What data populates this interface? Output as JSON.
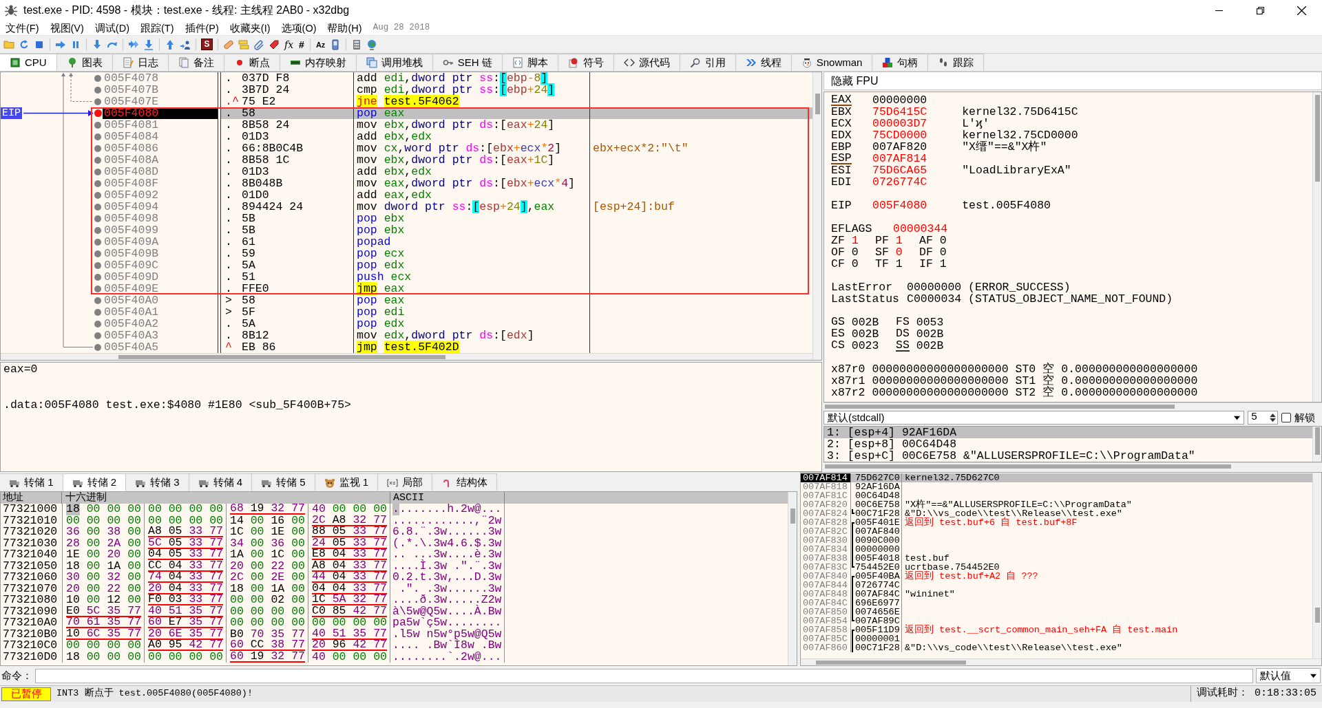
{
  "window": {
    "title": "test.exe - PID: 4598 - 模块：test.exe - 线程: 主线程 2AB0 - x32dbg"
  },
  "menu": {
    "items": [
      "文件(F)",
      "视图(V)",
      "调试(D)",
      "跟踪(T)",
      "插件(P)",
      "收藏夹(I)",
      "选项(O)",
      "帮助(H)"
    ],
    "build_date": "Aug 28 2018"
  },
  "toolbar": {
    "glyph_buttons": [
      "S",
      "fx",
      "#",
      "Az"
    ]
  },
  "tabs": [
    {
      "label": "CPU",
      "selected": true
    },
    {
      "label": "图表",
      "selected": false
    },
    {
      "label": "日志",
      "selected": false
    },
    {
      "label": "备注",
      "selected": false
    },
    {
      "label": "断点",
      "selected": false
    },
    {
      "label": "内存映射",
      "selected": false
    },
    {
      "label": "调用堆栈",
      "selected": false
    },
    {
      "label": "SEH 链",
      "selected": false
    },
    {
      "label": "脚本",
      "selected": false
    },
    {
      "label": "符号",
      "selected": false
    },
    {
      "label": "源代码",
      "selected": false
    },
    {
      "label": "引用",
      "selected": false
    },
    {
      "label": "线程",
      "selected": false
    },
    {
      "label": "Snowman",
      "selected": false
    },
    {
      "label": "句柄",
      "selected": false
    },
    {
      "label": "跟踪",
      "selected": false
    }
  ],
  "disassembly": {
    "eip_label": "EIP",
    "rows_above": [
      {
        "address": "005F4078",
        "mark": {
          "text": ".",
          "kind": "plain"
        },
        "bytes": "037D F8",
        "mnemonic": {
          "kind": "general",
          "text": "add"
        },
        "operands": [
          {
            "kind": "reg",
            "text": "edi"
          },
          {
            "kind": "plain",
            "text": ","
          },
          {
            "kind": "size",
            "text": "dword ptr"
          },
          {
            "kind": "seg",
            "text": "ss"
          },
          {
            "kind": "plain",
            "text": ":"
          },
          {
            "kind": "sbr",
            "text": "["
          },
          {
            "kind": "base",
            "text": "ebp"
          },
          {
            "kind": "op",
            "text": "-"
          },
          {
            "kind": "val",
            "text": "8"
          },
          {
            "kind": "sbr",
            "text": "]"
          }
        ],
        "breakpoint": false,
        "selected": false
      },
      {
        "address": "005F407B",
        "mark": {
          "text": ".",
          "kind": "plain"
        },
        "bytes": "3B7D 24",
        "mnemonic": {
          "kind": "general",
          "text": "cmp"
        },
        "operands": [
          {
            "kind": "reg",
            "text": "edi"
          },
          {
            "kind": "plain",
            "text": ","
          },
          {
            "kind": "size",
            "text": "dword ptr"
          },
          {
            "kind": "seg",
            "text": "ss"
          },
          {
            "kind": "plain",
            "text": ":"
          },
          {
            "kind": "sbr",
            "text": "["
          },
          {
            "kind": "base",
            "text": "ebp"
          },
          {
            "kind": "op",
            "text": "+"
          },
          {
            "kind": "val",
            "text": "24"
          },
          {
            "kind": "sbr",
            "text": "]"
          }
        ],
        "breakpoint": false,
        "selected": false
      },
      {
        "address": "005F407E",
        "mark": {
          "text": ".^",
          "kind": "jump"
        },
        "bytes": "75 E2",
        "mnemonic": {
          "kind": "jcc",
          "text": "jne"
        },
        "operands": [
          {
            "kind": "target",
            "text": "test.5F4062"
          }
        ],
        "breakpoint": false,
        "selected": false
      }
    ],
    "marked_rows": [
      {
        "address": "005F4080",
        "mark": {
          "text": ".",
          "kind": "plain"
        },
        "bytes": "58",
        "mnemonic": {
          "kind": "pushpop",
          "text": "pop"
        },
        "operands": [
          {
            "kind": "reg",
            "text": "eax"
          }
        ],
        "breakpoint": true,
        "selected": true
      },
      {
        "address": "005F4081",
        "mark": {
          "text": ".",
          "kind": "plain"
        },
        "bytes": "8B58 24",
        "mnemonic": {
          "kind": "general",
          "text": "mov"
        },
        "operands": [
          {
            "kind": "reg",
            "text": "ebx"
          },
          {
            "kind": "plain",
            "text": ","
          },
          {
            "kind": "size",
            "text": "dword ptr"
          },
          {
            "kind": "seg",
            "text": "ds"
          },
          {
            "kind": "plain",
            "text": ":"
          },
          {
            "kind": "br",
            "text": "["
          },
          {
            "kind": "base",
            "text": "eax"
          },
          {
            "kind": "op",
            "text": "+"
          },
          {
            "kind": "val",
            "text": "24"
          },
          {
            "kind": "br",
            "text": "]"
          }
        ],
        "breakpoint": false,
        "selected": false
      },
      {
        "address": "005F4084",
        "mark": {
          "text": ".",
          "kind": "plain"
        },
        "bytes": "01D3",
        "mnemonic": {
          "kind": "general",
          "text": "add"
        },
        "operands": [
          {
            "kind": "reg",
            "text": "ebx"
          },
          {
            "kind": "plain",
            "text": ","
          },
          {
            "kind": "reg",
            "text": "edx"
          }
        ],
        "breakpoint": false,
        "selected": false
      },
      {
        "address": "005F4086",
        "mark": {
          "text": ".",
          "kind": "plain"
        },
        "bytes": "66:8B0C4B",
        "mnemonic": {
          "kind": "general",
          "text": "mov"
        },
        "operands": [
          {
            "kind": "reg",
            "text": "cx"
          },
          {
            "kind": "plain",
            "text": ","
          },
          {
            "kind": "size",
            "text": "word ptr"
          },
          {
            "kind": "seg",
            "text": "ds"
          },
          {
            "kind": "plain",
            "text": ":"
          },
          {
            "kind": "br",
            "text": "["
          },
          {
            "kind": "base",
            "text": "ebx"
          },
          {
            "kind": "op",
            "text": "+"
          },
          {
            "kind": "idx",
            "text": "ecx"
          },
          {
            "kind": "op",
            "text": "*"
          },
          {
            "kind": "scale",
            "text": "2"
          },
          {
            "kind": "br",
            "text": "]"
          }
        ],
        "comment": "ebx+ecx*2:\"\\t\"",
        "breakpoint": false,
        "selected": false
      },
      {
        "address": "005F408A",
        "mark": {
          "text": ".",
          "kind": "plain"
        },
        "bytes": "8B58 1C",
        "mnemonic": {
          "kind": "general",
          "text": "mov"
        },
        "operands": [
          {
            "kind": "reg",
            "text": "ebx"
          },
          {
            "kind": "plain",
            "text": ","
          },
          {
            "kind": "size",
            "text": "dword ptr"
          },
          {
            "kind": "seg",
            "text": "ds"
          },
          {
            "kind": "plain",
            "text": ":"
          },
          {
            "kind": "br",
            "text": "["
          },
          {
            "kind": "base",
            "text": "eax"
          },
          {
            "kind": "op",
            "text": "+"
          },
          {
            "kind": "val",
            "text": "1C"
          },
          {
            "kind": "br",
            "text": "]"
          }
        ],
        "breakpoint": false,
        "selected": false
      },
      {
        "address": "005F408D",
        "mark": {
          "text": ".",
          "kind": "plain"
        },
        "bytes": "01D3",
        "mnemonic": {
          "kind": "general",
          "text": "add"
        },
        "operands": [
          {
            "kind": "reg",
            "text": "ebx"
          },
          {
            "kind": "plain",
            "text": ","
          },
          {
            "kind": "reg",
            "text": "edx"
          }
        ],
        "breakpoint": false,
        "selected": false
      },
      {
        "address": "005F408F",
        "mark": {
          "text": ".",
          "kind": "plain"
        },
        "bytes": "8B048B",
        "mnemonic": {
          "kind": "general",
          "text": "mov"
        },
        "operands": [
          {
            "kind": "reg",
            "text": "eax"
          },
          {
            "kind": "plain",
            "text": ","
          },
          {
            "kind": "size",
            "text": "dword ptr"
          },
          {
            "kind": "seg",
            "text": "ds"
          },
          {
            "kind": "plain",
            "text": ":"
          },
          {
            "kind": "br",
            "text": "["
          },
          {
            "kind": "base",
            "text": "ebx"
          },
          {
            "kind": "op",
            "text": "+"
          },
          {
            "kind": "idx",
            "text": "ecx"
          },
          {
            "kind": "op",
            "text": "*"
          },
          {
            "kind": "scale",
            "text": "4"
          },
          {
            "kind": "br",
            "text": "]"
          }
        ],
        "breakpoint": false,
        "selected": false
      },
      {
        "address": "005F4092",
        "mark": {
          "text": ".",
          "kind": "plain"
        },
        "bytes": "01D0",
        "mnemonic": {
          "kind": "general",
          "text": "add"
        },
        "operands": [
          {
            "kind": "reg",
            "text": "eax"
          },
          {
            "kind": "plain",
            "text": ","
          },
          {
            "kind": "reg",
            "text": "edx"
          }
        ],
        "breakpoint": false,
        "selected": false
      },
      {
        "address": "005F4094",
        "mark": {
          "text": ".",
          "kind": "plain"
        },
        "bytes": "894424 24",
        "mnemonic": {
          "kind": "general",
          "text": "mov"
        },
        "operands": [
          {
            "kind": "size",
            "text": "dword ptr"
          },
          {
            "kind": "seg",
            "text": "ss"
          },
          {
            "kind": "plain",
            "text": ":"
          },
          {
            "kind": "sbr",
            "text": "["
          },
          {
            "kind": "base",
            "text": "esp"
          },
          {
            "kind": "op",
            "text": "+"
          },
          {
            "kind": "val",
            "text": "24"
          },
          {
            "kind": "sbr",
            "text": "]"
          },
          {
            "kind": "plain",
            "text": ","
          },
          {
            "kind": "reg",
            "text": "eax"
          }
        ],
        "comment": "[esp+24]:buf",
        "breakpoint": false,
        "selected": false
      },
      {
        "address": "005F4098",
        "mark": {
          "text": ".",
          "kind": "plain"
        },
        "bytes": "5B",
        "mnemonic": {
          "kind": "pushpop",
          "text": "pop"
        },
        "operands": [
          {
            "kind": "reg",
            "text": "ebx"
          }
        ],
        "breakpoint": false,
        "selected": false
      },
      {
        "address": "005F4099",
        "mark": {
          "text": ".",
          "kind": "plain"
        },
        "bytes": "5B",
        "mnemonic": {
          "kind": "pushpop",
          "text": "pop"
        },
        "operands": [
          {
            "kind": "reg",
            "text": "ebx"
          }
        ],
        "breakpoint": false,
        "selected": false
      },
      {
        "address": "005F409A",
        "mark": {
          "text": ".",
          "kind": "plain"
        },
        "bytes": "61",
        "mnemonic": {
          "kind": "pushpop",
          "text": "popad"
        },
        "breakpoint": false,
        "selected": false
      },
      {
        "address": "005F409B",
        "mark": {
          "text": ".",
          "kind": "plain"
        },
        "bytes": "59",
        "mnemonic": {
          "kind": "pushpop",
          "text": "pop"
        },
        "operands": [
          {
            "kind": "reg",
            "text": "ecx"
          }
        ],
        "breakpoint": false,
        "selected": false
      },
      {
        "address": "005F409C",
        "mark": {
          "text": ".",
          "kind": "plain"
        },
        "bytes": "5A",
        "mnemonic": {
          "kind": "pushpop",
          "text": "pop"
        },
        "operands": [
          {
            "kind": "reg",
            "text": "edx"
          }
        ],
        "breakpoint": false,
        "selected": false
      },
      {
        "address": "005F409D",
        "mark": {
          "text": ".",
          "kind": "plain"
        },
        "bytes": "51",
        "mnemonic": {
          "kind": "pushpop",
          "text": "push"
        },
        "operands": [
          {
            "kind": "reg",
            "text": "ecx"
          }
        ],
        "breakpoint": false,
        "selected": false
      },
      {
        "address": "005F409E",
        "mark": {
          "text": ".",
          "kind": "plain"
        },
        "bytes": "FFE0",
        "mnemonic": {
          "kind": "jmp",
          "text": "jmp"
        },
        "operands": [
          {
            "kind": "reg",
            "text": "eax"
          }
        ],
        "breakpoint": false,
        "selected": false
      }
    ],
    "rows_below": [
      {
        "address": "005F40A0",
        "mark": {
          "text": ">",
          "kind": "plain"
        },
        "bytes": "58",
        "mnemonic": {
          "kind": "pushpop",
          "text": "pop"
        },
        "operands": [
          {
            "kind": "reg",
            "text": "eax"
          }
        ],
        "breakpoint": false,
        "selected": false
      },
      {
        "address": "005F40A1",
        "mark": {
          "text": ">",
          "kind": "plain"
        },
        "bytes": "5F",
        "mnemonic": {
          "kind": "pushpop",
          "text": "pop"
        },
        "operands": [
          {
            "kind": "reg",
            "text": "edi"
          }
        ],
        "breakpoint": false,
        "selected": false
      },
      {
        "address": "005F40A2",
        "mark": {
          "text": ".",
          "kind": "plain"
        },
        "bytes": "5A",
        "mnemonic": {
          "kind": "pushpop",
          "text": "pop"
        },
        "operands": [
          {
            "kind": "reg",
            "text": "edx"
          }
        ],
        "breakpoint": false,
        "selected": false
      },
      {
        "address": "005F40A3",
        "mark": {
          "text": ".",
          "kind": "plain"
        },
        "bytes": "8B12",
        "mnemonic": {
          "kind": "general",
          "text": "mov"
        },
        "operands": [
          {
            "kind": "reg",
            "text": "edx"
          },
          {
            "kind": "plain",
            "text": ","
          },
          {
            "kind": "size",
            "text": "dword ptr"
          },
          {
            "kind": "seg",
            "text": "ds"
          },
          {
            "kind": "plain",
            "text": ":"
          },
          {
            "kind": "br",
            "text": "["
          },
          {
            "kind": "base",
            "text": "edx"
          },
          {
            "kind": "br",
            "text": "]"
          }
        ],
        "breakpoint": false,
        "selected": false
      },
      {
        "address": "005F40A5",
        "mark": {
          "text": "^",
          "kind": "jump"
        },
        "bytes": "EB 86",
        "mnemonic": {
          "kind": "jmp",
          "text": "jmp"
        },
        "operands": [
          {
            "kind": "target",
            "text": "test.5F402D"
          }
        ],
        "breakpoint": false,
        "selected": false
      }
    ]
  },
  "info": {
    "lines": [
      "eax=0",
      ".data:005F4080 test.exe:$4080 #1E80 <sub_5F400B+75>"
    ]
  },
  "registers": {
    "fpu_toggle": "隐藏 FPU",
    "lines": [
      {
        "kind": "reg",
        "name": "EAX",
        "value": "00000000",
        "changed": false,
        "referenced": true
      },
      {
        "kind": "reg",
        "name": "EBX",
        "value": "75D6415C",
        "comment": "kernel32.75D6415C",
        "changed": true,
        "referenced": false
      },
      {
        "kind": "reg",
        "name": "ECX",
        "value": "000003D7",
        "comment": "L'ϗ'",
        "changed": true,
        "referenced": false
      },
      {
        "kind": "reg",
        "name": "EDX",
        "value": "75CD0000",
        "comment": "kernel32.75CD0000",
        "changed": true,
        "referenced": false
      },
      {
        "kind": "reg",
        "name": "EBP",
        "value": "007AF820",
        "comment": "\"X缙\"==&\"X杵\"",
        "changed": false,
        "referenced": false
      },
      {
        "kind": "reg",
        "name": "ESP",
        "value": "007AF814",
        "changed": true,
        "referenced": true
      },
      {
        "kind": "reg",
        "name": "ESI",
        "value": "75D6CA65",
        "comment": "\"LoadLibraryExA\"",
        "changed": true,
        "referenced": false
      },
      {
        "kind": "reg",
        "name": "EDI",
        "value": "0726774C",
        "changed": true,
        "referenced": false
      },
      {
        "kind": "gap"
      },
      {
        "kind": "reg",
        "name": "EIP",
        "value": "005F4080",
        "comment": "test.005F4080",
        "changed": true,
        "referenced": false
      },
      {
        "kind": "gap"
      },
      {
        "kind": "eflags",
        "name": "EFLAGS",
        "value": "00000344",
        "changed": true,
        "referenced": false
      },
      {
        "kind": "flags",
        "items": [
          {
            "name": "ZF",
            "value": "1",
            "changed": true
          },
          {
            "name": "PF",
            "value": "1",
            "changed": true
          },
          {
            "name": "AF",
            "value": "0",
            "changed": false
          }
        ]
      },
      {
        "kind": "flags",
        "items": [
          {
            "name": "OF",
            "value": "0",
            "changed": false
          },
          {
            "name": "SF",
            "value": "0",
            "changed": true
          },
          {
            "name": "DF",
            "value": "0",
            "changed": false
          }
        ]
      },
      {
        "kind": "flags",
        "items": [
          {
            "name": "CF",
            "value": "0",
            "changed": false
          },
          {
            "name": "TF",
            "value": "1",
            "changed": false
          },
          {
            "name": "IF",
            "value": "1",
            "changed": false
          }
        ]
      },
      {
        "kind": "gap"
      },
      {
        "kind": "status",
        "name": "LastError",
        "value": "00000000 (ERROR_SUCCESS)"
      },
      {
        "kind": "status",
        "name": "LastStatus",
        "value": "C0000034 (STATUS_OBJECT_NAME_NOT_FOUND)"
      },
      {
        "kind": "gap"
      },
      {
        "kind": "segments",
        "items": [
          {
            "name": "GS",
            "value": "002B",
            "referenced": false
          },
          {
            "name": "FS",
            "value": "0053",
            "referenced": false
          }
        ]
      },
      {
        "kind": "segments",
        "items": [
          {
            "name": "ES",
            "value": "002B",
            "referenced": false
          },
          {
            "name": "DS",
            "value": "002B",
            "referenced": false
          }
        ]
      },
      {
        "kind": "segments",
        "items": [
          {
            "name": "CS",
            "value": "0023",
            "referenced": false
          },
          {
            "name": "SS",
            "value": "002B",
            "referenced": true
          }
        ]
      },
      {
        "kind": "gap"
      },
      {
        "kind": "fpu",
        "name": "x87r0",
        "value": "00000000000000000000",
        "st": "ST0",
        "tag": "空",
        "number": "0.000000000000000000"
      },
      {
        "kind": "fpu",
        "name": "x87r1",
        "value": "00000000000000000000",
        "st": "ST1",
        "tag": "空",
        "number": "0.000000000000000000"
      },
      {
        "kind": "fpu",
        "name": "x87r2",
        "value": "00000000000000000000",
        "st": "ST2",
        "tag": "空",
        "number": "0.000000000000000000"
      }
    ]
  },
  "arguments": {
    "convention": "默认(stdcall)",
    "count": "5",
    "lock_label": "解锁",
    "locked": false,
    "rows": [
      {
        "text": "1: [esp+4] 92AF16DA",
        "selected": true
      },
      {
        "text": "2: [esp+8] 00C64D48",
        "selected": false
      },
      {
        "text": "3: [esp+C] 00C6E758 &\"ALLUSERSPROFILE=C:\\\\ProgramData\"",
        "selected": false
      }
    ]
  },
  "dump_tabs": [
    {
      "label": "转储 1",
      "selected": false
    },
    {
      "label": "转储 2",
      "selected": true
    },
    {
      "label": "转储 3",
      "selected": false
    },
    {
      "label": "转储 4",
      "selected": false
    },
    {
      "label": "转储 5",
      "selected": false
    },
    {
      "label": "监视 1",
      "selected": false
    },
    {
      "label": "局部",
      "selected": false
    },
    {
      "label": "结构体",
      "selected": false
    }
  ],
  "dump": {
    "columns": [
      "地址",
      "十六进制",
      "ASCII"
    ],
    "rows": [
      {
        "address": "77321000",
        "groups": [
          {
            "bytes": "18 00 00 00",
            "pointer": false
          },
          {
            "bytes": "00 00 00 00",
            "pointer": false
          },
          {
            "bytes": "68 19 32 77",
            "pointer": true
          },
          {
            "bytes": "40 00 00 00",
            "pointer": false
          }
        ],
        "ascii": "........h.2w@...",
        "cursor": true
      },
      {
        "address": "77321010",
        "groups": [
          {
            "bytes": "00 00 00 00",
            "pointer": false
          },
          {
            "bytes": "00 00 00 00",
            "pointer": false
          },
          {
            "bytes": "14 00 16 00",
            "pointer": false
          },
          {
            "bytes": "2C A8 32 77",
            "pointer": true
          }
        ],
        "ascii": "............,¨2w",
        "cursor": false
      },
      {
        "address": "77321020",
        "groups": [
          {
            "bytes": "36 00 38 00",
            "pointer": false
          },
          {
            "bytes": "A8 05 33 77",
            "pointer": true
          },
          {
            "bytes": "1C 00 1E 00",
            "pointer": false
          },
          {
            "bytes": "88 05 33 77",
            "pointer": true
          }
        ],
        "ascii": "6.8.¨.3w......3w",
        "cursor": false
      },
      {
        "address": "77321030",
        "groups": [
          {
            "bytes": "28 00 2A 00",
            "pointer": false
          },
          {
            "bytes": "5C 05 33 77",
            "pointer": true
          },
          {
            "bytes": "34 00 36 00",
            "pointer": false
          },
          {
            "bytes": "24 05 33 77",
            "pointer": true
          }
        ],
        "ascii": "(.*.\\.3w4.6.$.3w",
        "cursor": false
      },
      {
        "address": "77321040",
        "groups": [
          {
            "bytes": "1E 00 20 00",
            "pointer": false
          },
          {
            "bytes": "04 05 33 77",
            "pointer": true
          },
          {
            "bytes": "1A 00 1C 00",
            "pointer": false
          },
          {
            "bytes": "E8 04 33 77",
            "pointer": true
          }
        ],
        "ascii": ".. ...3w....è.3w",
        "cursor": false
      },
      {
        "address": "77321050",
        "groups": [
          {
            "bytes": "18 00 1A 00",
            "pointer": false
          },
          {
            "bytes": "CC 04 33 77",
            "pointer": true
          },
          {
            "bytes": "20 00 22 00",
            "pointer": false
          },
          {
            "bytes": "A8 04 33 77",
            "pointer": true
          }
        ],
        "ascii": "....Ì.3w .\".¨.3w",
        "cursor": false
      },
      {
        "address": "77321060",
        "groups": [
          {
            "bytes": "30 00 32 00",
            "pointer": false
          },
          {
            "bytes": "74 04 33 77",
            "pointer": true
          },
          {
            "bytes": "2C 00 2E 00",
            "pointer": false
          },
          {
            "bytes": "44 04 33 77",
            "pointer": true
          }
        ],
        "ascii": "0.2.t.3w,...D.3w",
        "cursor": false
      },
      {
        "address": "77321070",
        "groups": [
          {
            "bytes": "20 00 22 00",
            "pointer": false
          },
          {
            "bytes": "20 04 33 77",
            "pointer": true
          },
          {
            "bytes": "18 00 1A 00",
            "pointer": false
          },
          {
            "bytes": "04 04 33 77",
            "pointer": true
          }
        ],
        "ascii": " .\". .3w......3w",
        "cursor": false
      },
      {
        "address": "77321080",
        "groups": [
          {
            "bytes": "10 00 12 00",
            "pointer": false
          },
          {
            "bytes": "F0 03 33 77",
            "pointer": true
          },
          {
            "bytes": "00 00 02 00",
            "pointer": false
          },
          {
            "bytes": "1C 5A 32 77",
            "pointer": true
          }
        ],
        "ascii": "....ð.3w.....Z2w",
        "cursor": false
      },
      {
        "address": "77321090",
        "groups": [
          {
            "bytes": "E0 5C 35 77",
            "pointer": true
          },
          {
            "bytes": "40 51 35 77",
            "pointer": true
          },
          {
            "bytes": "00 00 00 00",
            "pointer": false
          },
          {
            "bytes": "C0 85 42 77",
            "pointer": true
          }
        ],
        "ascii": "à\\5w@Q5w....À.Bw",
        "cursor": false
      },
      {
        "address": "773210A0",
        "groups": [
          {
            "bytes": "70 61 35 77",
            "pointer": true
          },
          {
            "bytes": "60 E7 35 77",
            "pointer": true
          },
          {
            "bytes": "00 00 00 00",
            "pointer": false
          },
          {
            "bytes": "00 00 00 00",
            "pointer": false
          }
        ],
        "ascii": "pa5w`ç5w........",
        "cursor": false
      },
      {
        "address": "773210B0",
        "groups": [
          {
            "bytes": "10 6C 35 77",
            "pointer": true
          },
          {
            "bytes": "20 6E 35 77",
            "pointer": true
          },
          {
            "bytes": "B0 70 35 77",
            "pointer": false
          },
          {
            "bytes": "40 51 35 77",
            "pointer": true
          }
        ],
        "ascii": ".l5w n5w°p5w@Q5w",
        "cursor": false
      },
      {
        "address": "773210C0",
        "groups": [
          {
            "bytes": "00 00 00 00",
            "pointer": false
          },
          {
            "bytes": "A0 95 42 77",
            "pointer": true
          },
          {
            "bytes": "60 CC 38 77",
            "pointer": true
          },
          {
            "bytes": "20 96 42 77",
            "pointer": true
          }
        ],
        "ascii": ".... .Bw`Ì8w .Bw",
        "cursor": false
      },
      {
        "address": "773210D0",
        "groups": [
          {
            "bytes": "18 00 00 00",
            "pointer": false
          },
          {
            "bytes": "00 00 00 00",
            "pointer": false
          },
          {
            "bytes": "60 19 32 77",
            "pointer": true
          },
          {
            "bytes": "40 00 00 00",
            "pointer": false
          }
        ],
        "ascii": "........`.2w@...",
        "cursor": false
      }
    ]
  },
  "stack": {
    "rows": [
      {
        "address": "007AF814",
        "value": "75D627C0",
        "comment": {
          "text": "kernel32.75D627C0",
          "kind": "plain"
        },
        "kind": "plain",
        "selected": true
      },
      {
        "address": "007AF818",
        "value": "92AF16DA",
        "kind": "plain",
        "selected": false
      },
      {
        "address": "007AF81C",
        "value": "00C64D48",
        "kind": "plain",
        "selected": false
      },
      {
        "address": "007AF820",
        "value": "00C6E758",
        "comment": {
          "text": "\"X杵\"==&\"ALLUSERSPROFILE=C:\\\\ProgramData\"",
          "kind": "plain"
        },
        "kind": "plain",
        "selected": false
      },
      {
        "address": "007AF824",
        "value": "00C71F28",
        "comment": {
          "text": "&\"D:\\\\vs_code\\\\test\\\\Release\\\\test.exe\"",
          "kind": "plain"
        },
        "kind": "frame_bottom",
        "selected": false
      },
      {
        "address": "007AF828",
        "value": "005F401E",
        "comment": {
          "text": "返回到 test.buf+6 自 test.buf+8F",
          "kind": "return"
        },
        "kind": "frame_top",
        "selected": false
      },
      {
        "address": "007AF82C",
        "value": "007AF840",
        "kind": "frame_middle",
        "selected": false
      },
      {
        "address": "007AF830",
        "value": "0090C000",
        "kind": "frame_middle",
        "selected": false
      },
      {
        "address": "007AF834",
        "value": "00000000",
        "kind": "frame_middle",
        "selected": false
      },
      {
        "address": "007AF838",
        "value": "005F4018",
        "comment": {
          "text": "test.buf",
          "kind": "plain"
        },
        "kind": "frame_middle",
        "selected": false
      },
      {
        "address": "007AF83C",
        "value": "754452E0",
        "comment": {
          "text": "ucrtbase.754452E0",
          "kind": "plain"
        },
        "kind": "frame_bottom",
        "selected": false
      },
      {
        "address": "007AF840",
        "value": "005F40BA",
        "comment": {
          "text": "返回到 test.buf+A2 自 ???",
          "kind": "return"
        },
        "kind": "frame_top",
        "selected": false
      },
      {
        "address": "007AF844",
        "value": "0726774C",
        "kind": "frame_middle",
        "selected": false
      },
      {
        "address": "007AF848",
        "value": "007AF84C",
        "comment": {
          "text": "\"wininet\"",
          "kind": "plain"
        },
        "kind": "frame_middle",
        "selected": false
      },
      {
        "address": "007AF84C",
        "value": "696E6977",
        "kind": "frame_middle",
        "selected": false
      },
      {
        "address": "007AF850",
        "value": "0074656E",
        "kind": "frame_middle",
        "selected": false
      },
      {
        "address": "007AF854",
        "value": "007AF89C",
        "kind": "frame_bottom",
        "selected": false
      },
      {
        "address": "007AF858",
        "value": "005F11D9",
        "comment": {
          "text": "返回到 test.__scrt_common_main_seh+FA 自 test.main",
          "kind": "return"
        },
        "kind": "frame_top",
        "selected": false
      },
      {
        "address": "007AF85C",
        "value": "00000001",
        "kind": "frame_middle",
        "selected": false
      },
      {
        "address": "007AF860",
        "value": "00C71F28",
        "comment": {
          "text": "&\"D:\\\\vs_code\\\\test\\\\Release\\\\test.exe\"",
          "kind": "plain"
        },
        "kind": "frame_middle",
        "selected": false
      }
    ]
  },
  "command": {
    "label": "命令：",
    "mode": "默认值"
  },
  "status_bar": {
    "state": "已暂停",
    "message": "INT3 断点于 test.005F4080(005F4080)!",
    "timer": "调试耗时： 0:18:33:05"
  }
}
